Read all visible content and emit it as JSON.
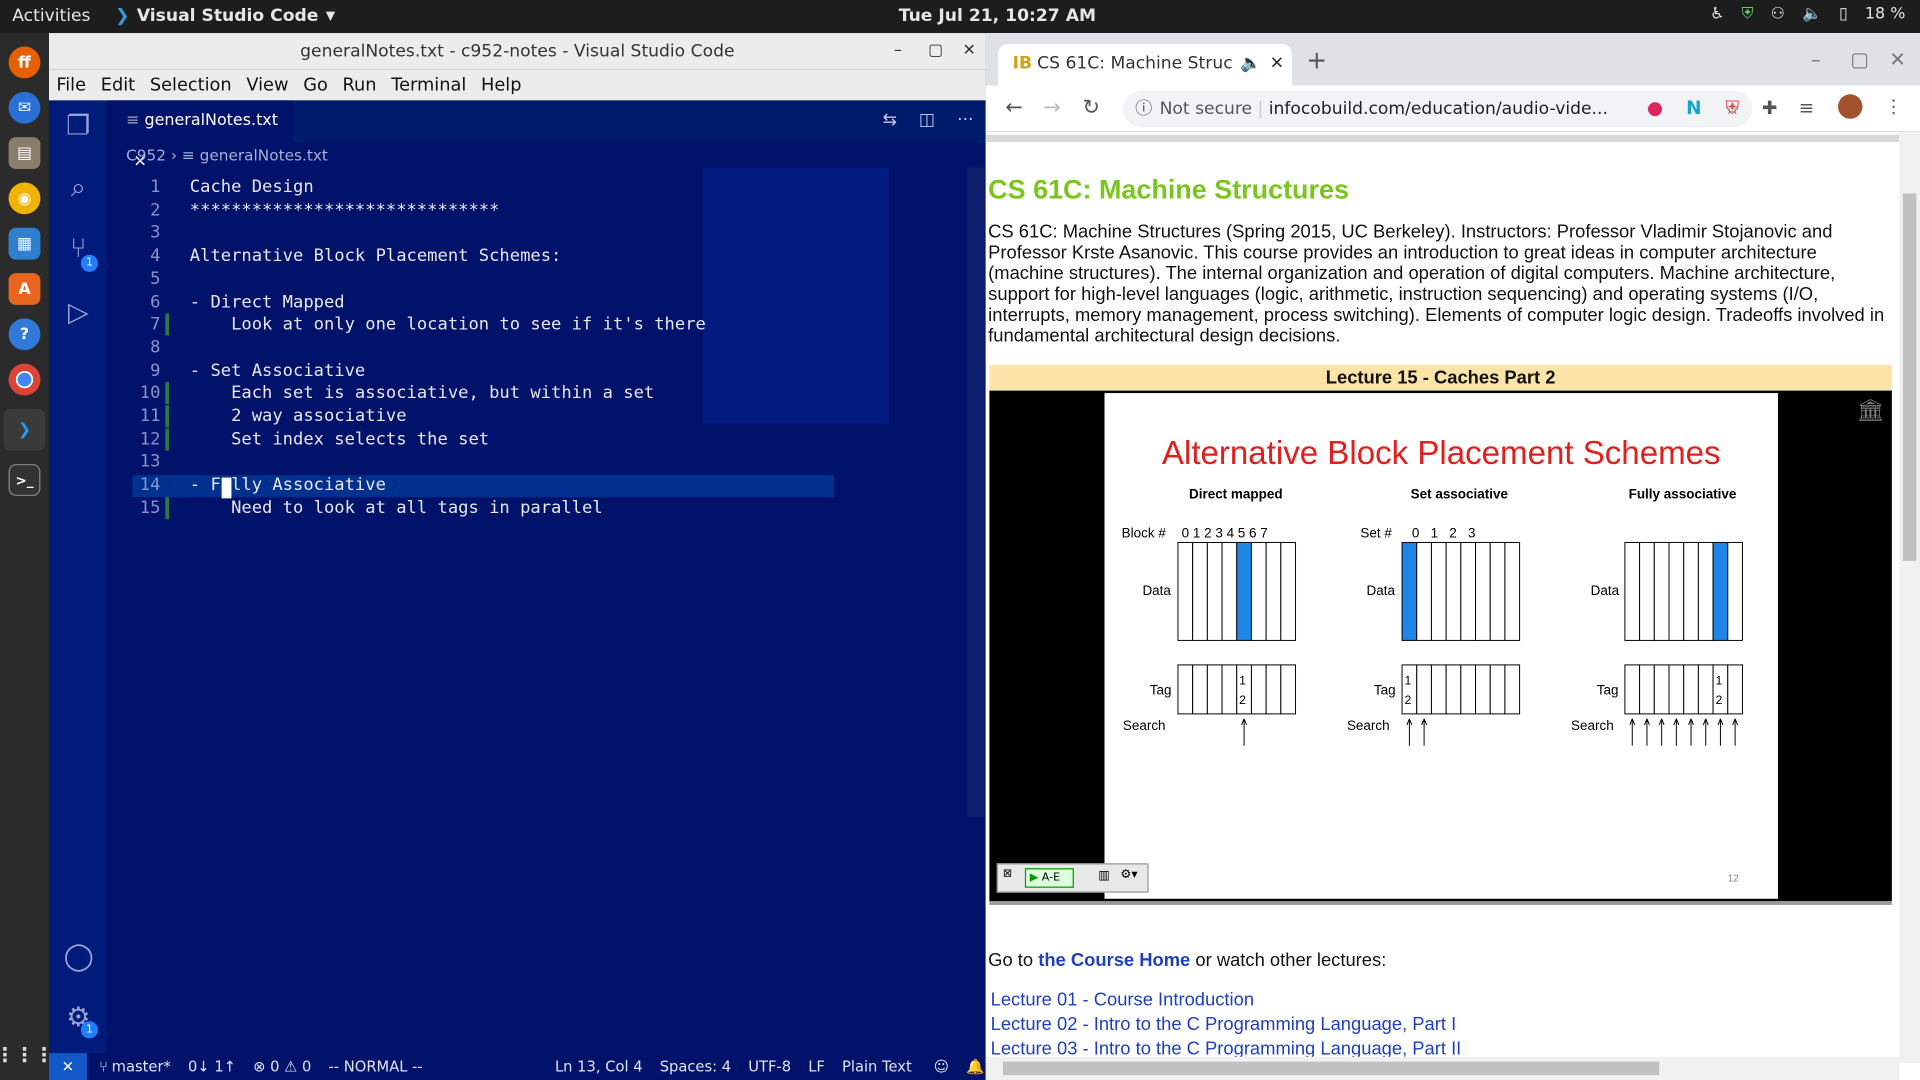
{
  "topbar": {
    "activities": "Activities",
    "app": "Visual Studio Code",
    "clock": "Tue Jul 21, 10:27 AM",
    "battery": "18 %"
  },
  "dock": {
    "items": [
      "firefox-icon",
      "thunderbird-icon",
      "files-icon",
      "rhythmbox-icon",
      "writer-icon",
      "software-icon",
      "help-icon",
      "chrome-icon",
      "vscode-icon",
      "terminal-icon"
    ]
  },
  "vscode": {
    "title": "generalNotes.txt - c952-notes - Visual Studio Code",
    "menu": [
      "File",
      "Edit",
      "Selection",
      "View",
      "Go",
      "Run",
      "Terminal",
      "Help"
    ],
    "tab": "generalNotes.txt",
    "breadcrumb_folder": "C952",
    "breadcrumb_file": "generalNotes.txt",
    "lines": [
      {
        "n": "1",
        "t": "Cache Design"
      },
      {
        "n": "2",
        "t": "******************************"
      },
      {
        "n": "3",
        "t": ""
      },
      {
        "n": "4",
        "t": "Alternative Block Placement Schemes:"
      },
      {
        "n": "5",
        "t": ""
      },
      {
        "n": "6",
        "t": "- Direct Mapped"
      },
      {
        "n": "7",
        "t": "    Look at only one location to see if it's there"
      },
      {
        "n": "8",
        "t": ""
      },
      {
        "n": "9",
        "t": "- Set Associative"
      },
      {
        "n": "10",
        "t": "    Each set is associative, but within a set"
      },
      {
        "n": "11",
        "t": "    2 way associative"
      },
      {
        "n": "12",
        "t": "    Set index selects the set"
      },
      {
        "n": "13",
        "t": ""
      },
      {
        "n": "14",
        "t": "- Fully Associative"
      },
      {
        "n": "15",
        "t": "    Need to look at all tags in parallel"
      }
    ],
    "status": {
      "branch": "master*",
      "sync": "0↓ 1↑",
      "problems": "⊗ 0 ⚠ 0",
      "mode": "-- NORMAL --",
      "pos": "Ln 13, Col 4",
      "spaces": "Spaces: 4",
      "enc": "UTF-8",
      "eol": "LF",
      "lang": "Plain Text"
    },
    "scm_badge": "1",
    "settings_badge": "1"
  },
  "chrome": {
    "tab_title": "CS 61C: Machine Struc",
    "not_secure": "Not secure",
    "url": "infocobuild.com/education/audio-vide...",
    "page": {
      "heading": "CS 61C: Machine Structures",
      "description": "CS 61C: Machine Structures (Spring 2015, UC Berkeley). Instructors: Professor Vladimir Stojanovic and Professor Krste Asanovic. This course provides an introduction to great ideas in computer architecture (machine structures). The internal organization and operation of digital computers. Machine architecture, support for high-level languages (logic, arithmetic, instruction sequencing) and operating systems (I/O, interrupts, memory management, process switching). Elements of computer logic design. Tradeoffs involved in fundamental architectural design decisions.",
      "lecture_header": "Lecture 15 - Caches Part 2",
      "slide": {
        "title": "Alternative Block Placement Schemes",
        "col1": "Direct mapped",
        "col2": "Set associative",
        "col3": "Fully associative",
        "block_label": "Block #",
        "block_nums": "0 1 2 3 4 5 6 7",
        "set_label": "Set #",
        "set_nums": "0   1   2   3",
        "data": "Data",
        "tag": "Tag",
        "search": "Search",
        "page_num": "12",
        "tag_num1": "1",
        "tag_num2": "2"
      },
      "player_btn": "A-E",
      "goto_prefix": "Go to ",
      "goto_link": "the Course Home",
      "goto_suffix": " or watch other lectures:",
      "lectures": [
        "Lecture 01 - Course Introduction",
        "Lecture 02 - Intro to the C Programming Language, Part I",
        "Lecture 03 - Intro to the C Programming Language, Part II"
      ]
    }
  },
  "colors": {
    "vscode_bg": "#00126a",
    "heading_green": "#7ac61e",
    "link_blue": "#1f3fbf",
    "slide_title_red": "#e0201c",
    "highlight_blue": "#1f86e8"
  }
}
